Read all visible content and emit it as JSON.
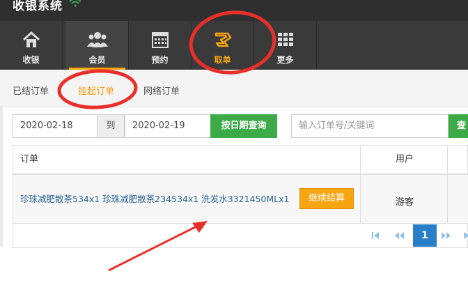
{
  "app": {
    "title": "收银系统"
  },
  "nav": [
    {
      "label": "收银",
      "icon": "home-icon"
    },
    {
      "label": "会员",
      "icon": "members-icon"
    },
    {
      "label": "预约",
      "icon": "calendar-icon"
    },
    {
      "label": "取单",
      "icon": "retrieve-order-icon"
    },
    {
      "label": "更多",
      "icon": "grid-icon"
    }
  ],
  "subtabs": [
    {
      "label": "已结订单"
    },
    {
      "label": "挂起订单"
    },
    {
      "label": "网络订单"
    }
  ],
  "filters": {
    "date_from": "2020-02-18",
    "date_sep": "到",
    "date_to": "2020-02-19",
    "date_query_button": "按日期查询",
    "search_placeholder": "输入订单号/关键词",
    "search_button": "查"
  },
  "table": {
    "headers": {
      "order": "订单",
      "user": "用户"
    },
    "rows": [
      {
        "order": "珍珠减肥散茶534x1 珍珠减肥散茶234534x1 洗发水3321450MLx1",
        "action": "继续结算",
        "user": "游客"
      }
    ]
  },
  "pagination": {
    "current": "1"
  },
  "colors": {
    "accent": "#f6a511",
    "green": "#3cab47",
    "annotation": "#e8302a"
  }
}
